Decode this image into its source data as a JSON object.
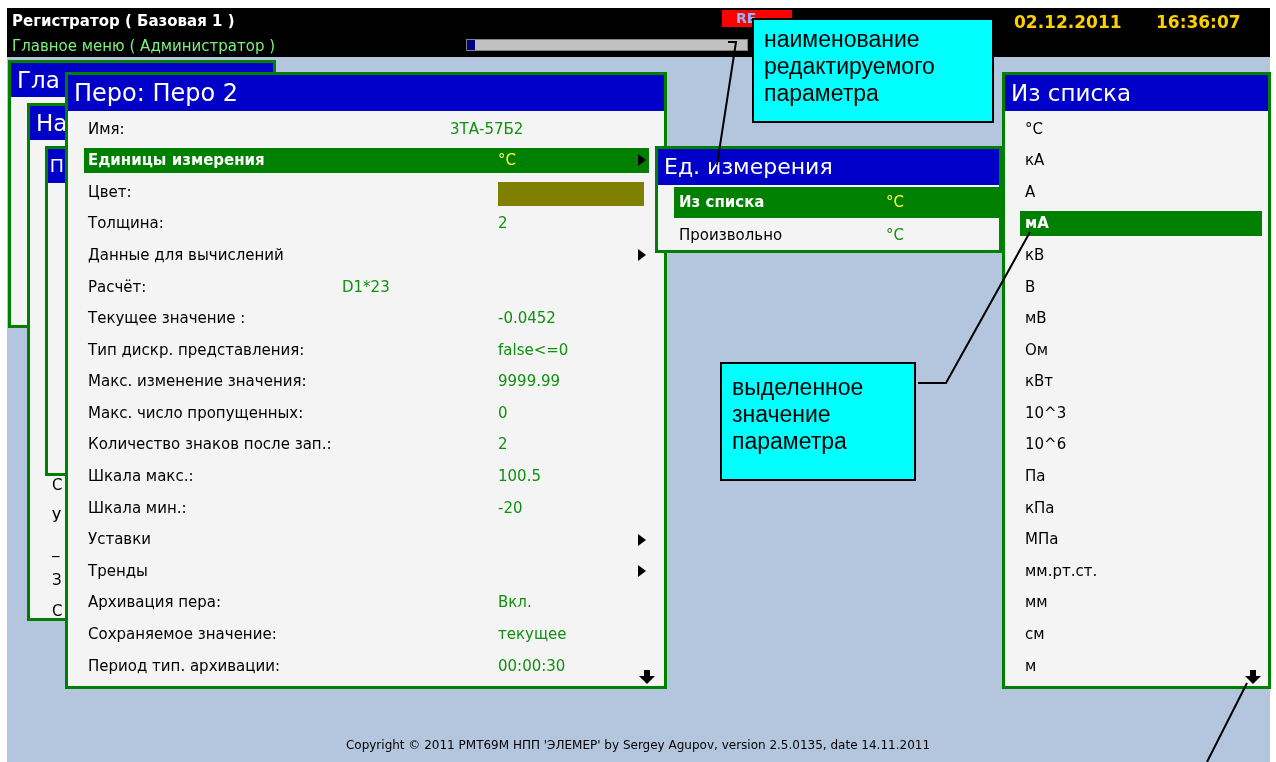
{
  "header": {
    "title": "Регистратор ( Базовая 1 )",
    "subtitle": "Главное меню ( Администратор )",
    "progress": {
      "level": 0.03
    },
    "rec_badge": "RE",
    "date": "02.12.2011",
    "time": "16:36:07"
  },
  "background_windows": [
    {
      "title": "Гла"
    },
    {
      "title": "На",
      "items": [
        "С",
        "У",
        "_",
        "З",
        "С"
      ]
    },
    {
      "title": "П"
    }
  ],
  "pen_window": {
    "title": "Перо: Перо 2",
    "more_below": true,
    "rows": [
      {
        "kind": "wide",
        "label": "Имя:",
        "value": "3ТА-57Б2",
        "selected": false,
        "submenu": false
      },
      {
        "kind": "field",
        "label": "Единицы измерения",
        "value": "°C",
        "selected": true,
        "submenu": true
      },
      {
        "kind": "color",
        "label": "Цвет:",
        "color": "#808000",
        "selected": false,
        "submenu": false
      },
      {
        "kind": "field",
        "label": "Толщина:",
        "value": "2",
        "selected": false,
        "submenu": false
      },
      {
        "kind": "field",
        "label": "Данные для вычислений",
        "selected": false,
        "submenu": true
      },
      {
        "kind": "formula",
        "label": "Расчёт:",
        "value": "D1*23",
        "selected": false,
        "submenu": false
      },
      {
        "kind": "field",
        "label": "Текущее значение :",
        "value": "-0.0452",
        "selected": false,
        "submenu": false
      },
      {
        "kind": "field",
        "label": "Тип дискр. представления:",
        "value": "false<=0",
        "selected": false,
        "submenu": false
      },
      {
        "kind": "field",
        "label": "Макс. изменение значения:",
        "value": "9999.99",
        "selected": false,
        "submenu": false
      },
      {
        "kind": "field",
        "label": "Макс. число пропущенных:",
        "value": "0",
        "selected": false,
        "submenu": false
      },
      {
        "kind": "field",
        "label": "Количество знаков после зап.:",
        "value": "2",
        "selected": false,
        "submenu": false
      },
      {
        "kind": "field",
        "label": "Шкала макс.:",
        "value": "100.5",
        "selected": false,
        "submenu": false
      },
      {
        "kind": "field",
        "label": "Шкала мин.:",
        "value": "-20",
        "selected": false,
        "submenu": false
      },
      {
        "kind": "field",
        "label": "Уставки",
        "selected": false,
        "submenu": true
      },
      {
        "kind": "field",
        "label": "Тренды",
        "selected": false,
        "submenu": true
      },
      {
        "kind": "field",
        "label": "Архивация пера:",
        "value": "Вкл.",
        "selected": false,
        "submenu": false
      },
      {
        "kind": "field",
        "label": "Сохраняемое значение:",
        "value": "текущее",
        "selected": false,
        "submenu": false
      },
      {
        "kind": "field",
        "label": "Период тип. архивации:",
        "value": "00:00:30",
        "selected": false,
        "submenu": false
      }
    ]
  },
  "units_window": {
    "title": "Ед. измерения",
    "rows": [
      {
        "label": "Из списка",
        "value": "°C",
        "selected": true
      },
      {
        "label": "Произвольно",
        "value": "°C",
        "selected": false
      }
    ]
  },
  "list_window": {
    "title": "Из списка",
    "more_below": true,
    "items": [
      {
        "label": "°C",
        "selected": false
      },
      {
        "label": "кА",
        "selected": false
      },
      {
        "label": "А",
        "selected": false
      },
      {
        "label": "мА",
        "selected": true
      },
      {
        "label": "кВ",
        "selected": false
      },
      {
        "label": "В",
        "selected": false
      },
      {
        "label": "мВ",
        "selected": false
      },
      {
        "label": "Ом",
        "selected": false
      },
      {
        "label": "кВт",
        "selected": false
      },
      {
        "label": "10^3",
        "selected": false
      },
      {
        "label": "10^6",
        "selected": false
      },
      {
        "label": "Па",
        "selected": false
      },
      {
        "label": "кПа",
        "selected": false
      },
      {
        "label": "МПа",
        "selected": false
      },
      {
        "label": "мм.рт.ст.",
        "selected": false
      },
      {
        "label": "мм",
        "selected": false
      },
      {
        "label": "см",
        "selected": false
      },
      {
        "label": "м",
        "selected": false
      }
    ]
  },
  "callouts": [
    "наименование редактируемого параметра",
    "выделенное значение параметра"
  ],
  "footer": "Copyright © 2011 РМТ69М НПП 'ЭЛЕМЕР' by Sergey Agupov, version 2.5.0135, date 14.11.2011"
}
